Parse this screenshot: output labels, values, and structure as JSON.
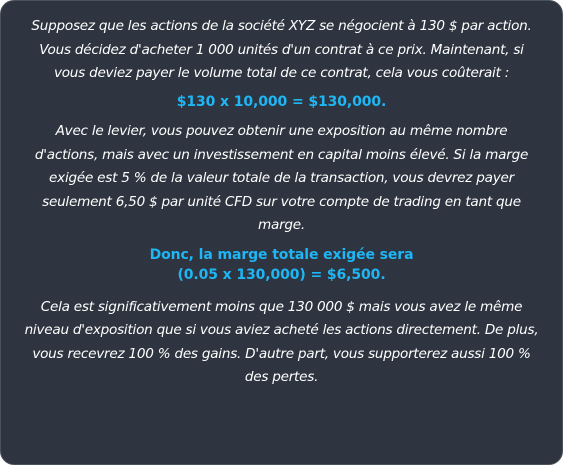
{
  "paragraphs": {
    "intro": "Supposez que les actions de la société XYZ se négocient à 130 $ par action. Vous décidez d'acheter 1 000 unités d'un contrat à ce prix. Maintenant, si vous deviez payer le volume total de ce contrat, cela vous coûterait :",
    "leverage": "Avec le levier, vous pouvez obtenir une exposition au même nombre d'actions, mais avec un investissement en capital moins élevé. Si la marge exigée est 5 % de la valeur totale de la transaction, vous devrez payer seulement 6,50 $ par unité CFD sur votre compte de trading en tant que marge.",
    "conclusion": "Cela est significativement moins que 130 000 $ mais vous avez le même niveau d'exposition que si vous aviez acheté les actions directement. De plus, vous recevrez 100 % des gains. D'autre part, vous supporterez aussi 100 % des pertes."
  },
  "highlights": {
    "total_cost": "$130 x 10,000 = $130,000.",
    "margin_line1": "Donc, la marge totale exigée sera",
    "margin_line2": "(0.05 x 130,000) = $6,500."
  },
  "colors": {
    "background": "#2e3540",
    "text": "#ffffff",
    "accent": "#1fb6f5"
  }
}
